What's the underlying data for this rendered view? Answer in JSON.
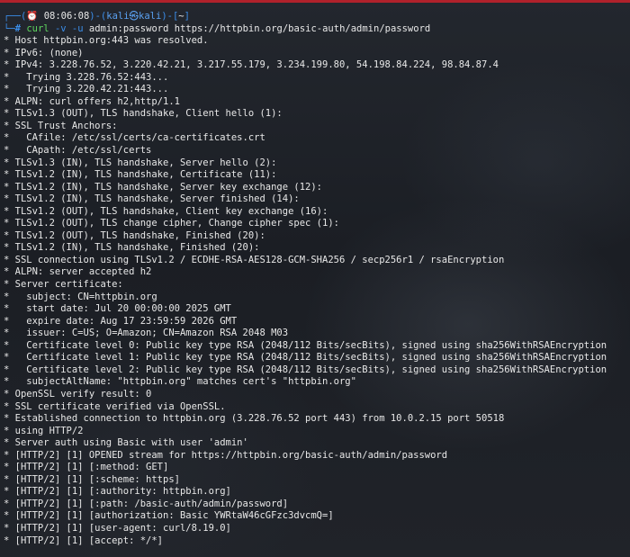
{
  "prompt": {
    "open": "┌──(",
    "alarm_icon": "⏰",
    "time": " 08:06:08",
    "sep1": ")-(",
    "user_host": "kali㉿kali",
    "sep2": ")-[",
    "cwd": "~",
    "close": "]",
    "second_prefix": "└─",
    "hash": "#"
  },
  "command": {
    "name": "curl",
    "opt_v": "-v",
    "opt_u": "-u",
    "credentials": "admin:password",
    "url": "https://httpbin.org/basic-auth/admin/password"
  },
  "output": [
    "* Host httpbin.org:443 was resolved.",
    "* IPv6: (none)",
    "* IPv4: 3.228.76.52, 3.220.42.21, 3.217.55.179, 3.234.199.80, 54.198.84.224, 98.84.87.4",
    "*   Trying 3.228.76.52:443...",
    "*   Trying 3.220.42.21:443...",
    "* ALPN: curl offers h2,http/1.1",
    "* TLSv1.3 (OUT), TLS handshake, Client hello (1):",
    "* SSL Trust Anchors:",
    "*   CAfile: /etc/ssl/certs/ca-certificates.crt",
    "*   CApath: /etc/ssl/certs",
    "* TLSv1.3 (IN), TLS handshake, Server hello (2):",
    "* TLSv1.2 (IN), TLS handshake, Certificate (11):",
    "* TLSv1.2 (IN), TLS handshake, Server key exchange (12):",
    "* TLSv1.2 (IN), TLS handshake, Server finished (14):",
    "* TLSv1.2 (OUT), TLS handshake, Client key exchange (16):",
    "* TLSv1.2 (OUT), TLS change cipher, Change cipher spec (1):",
    "* TLSv1.2 (OUT), TLS handshake, Finished (20):",
    "* TLSv1.2 (IN), TLS handshake, Finished (20):",
    "* SSL connection using TLSv1.2 / ECDHE-RSA-AES128-GCM-SHA256 / secp256r1 / rsaEncryption",
    "* ALPN: server accepted h2",
    "* Server certificate:",
    "*   subject: CN=httpbin.org",
    "*   start date: Jul 20 00:00:00 2025 GMT",
    "*   expire date: Aug 17 23:59:59 2026 GMT",
    "*   issuer: C=US; O=Amazon; CN=Amazon RSA 2048 M03",
    "*   Certificate level 0: Public key type RSA (2048/112 Bits/secBits), signed using sha256WithRSAEncryption",
    "*   Certificate level 1: Public key type RSA (2048/112 Bits/secBits), signed using sha256WithRSAEncryption",
    "*   Certificate level 2: Public key type RSA (2048/112 Bits/secBits), signed using sha256WithRSAEncryption",
    "*   subjectAltName: \"httpbin.org\" matches cert's \"httpbin.org\"",
    "* OpenSSL verify result: 0",
    "* SSL certificate verified via OpenSSL.",
    "* Established connection to httpbin.org (3.228.76.52 port 443) from 10.0.2.15 port 50518",
    "* using HTTP/2",
    "* Server auth using Basic with user 'admin'",
    "* [HTTP/2] [1] OPENED stream for https://httpbin.org/basic-auth/admin/password",
    "* [HTTP/2] [1] [:method: GET]",
    "* [HTTP/2] [1] [:scheme: https]",
    "* [HTTP/2] [1] [:authority: httpbin.org]",
    "* [HTTP/2] [1] [:path: /basic-auth/admin/password]",
    "* [HTTP/2] [1] [authorization: Basic YWRtaW46cGFzc3dvcmQ=]",
    "* [HTTP/2] [1] [user-agent: curl/8.19.0]",
    "* [HTTP/2] [1] [accept: */*]"
  ],
  "colors": {
    "accent_bar": "#b0212b",
    "prompt": "#3b8eea",
    "command": "#5fd75f",
    "text": "#e8e8e8"
  }
}
